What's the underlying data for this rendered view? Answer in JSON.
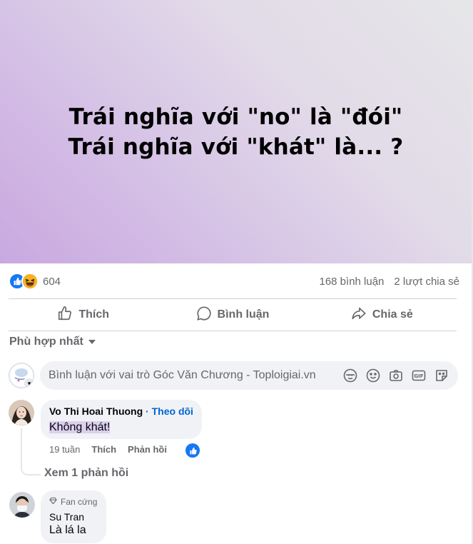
{
  "post": {
    "line1": "Trái nghĩa với \"no\" là \"đói\"",
    "line2": "Trái nghĩa với \"khát\" là... ?"
  },
  "stats": {
    "reaction_count": "604",
    "comments": "168 bình luận",
    "shares": "2 lượt chia sẻ",
    "reactions": [
      "like-icon",
      "haha-icon"
    ]
  },
  "actions": {
    "like": "Thích",
    "comment": "Bình luận",
    "share": "Chia sẻ"
  },
  "sort": {
    "label": "Phù hợp nhất"
  },
  "composer": {
    "placeholder": "Bình luận với vai trò Góc Văn Chương - Toploigiai.vn",
    "tools": [
      "avatar-sticker-icon",
      "emoji-icon",
      "camera-icon",
      "gif-icon",
      "sticker-icon"
    ]
  },
  "comments": [
    {
      "author": "Vo Thi Hoai Thuong",
      "follow": " · Theo dõi",
      "text": "Không khát!",
      "time": "19 tuần",
      "like": "Thích",
      "reply": "Phản hồi",
      "view_replies": "Xem 1 phản hồi"
    },
    {
      "badge": "Fan cứng",
      "author": "Su Tran",
      "text": "Là lá la"
    }
  ],
  "colors": {
    "accent": "#1877f2",
    "link": "#0064d1",
    "muted": "#65676b",
    "bubble": "#f0f2f5"
  }
}
